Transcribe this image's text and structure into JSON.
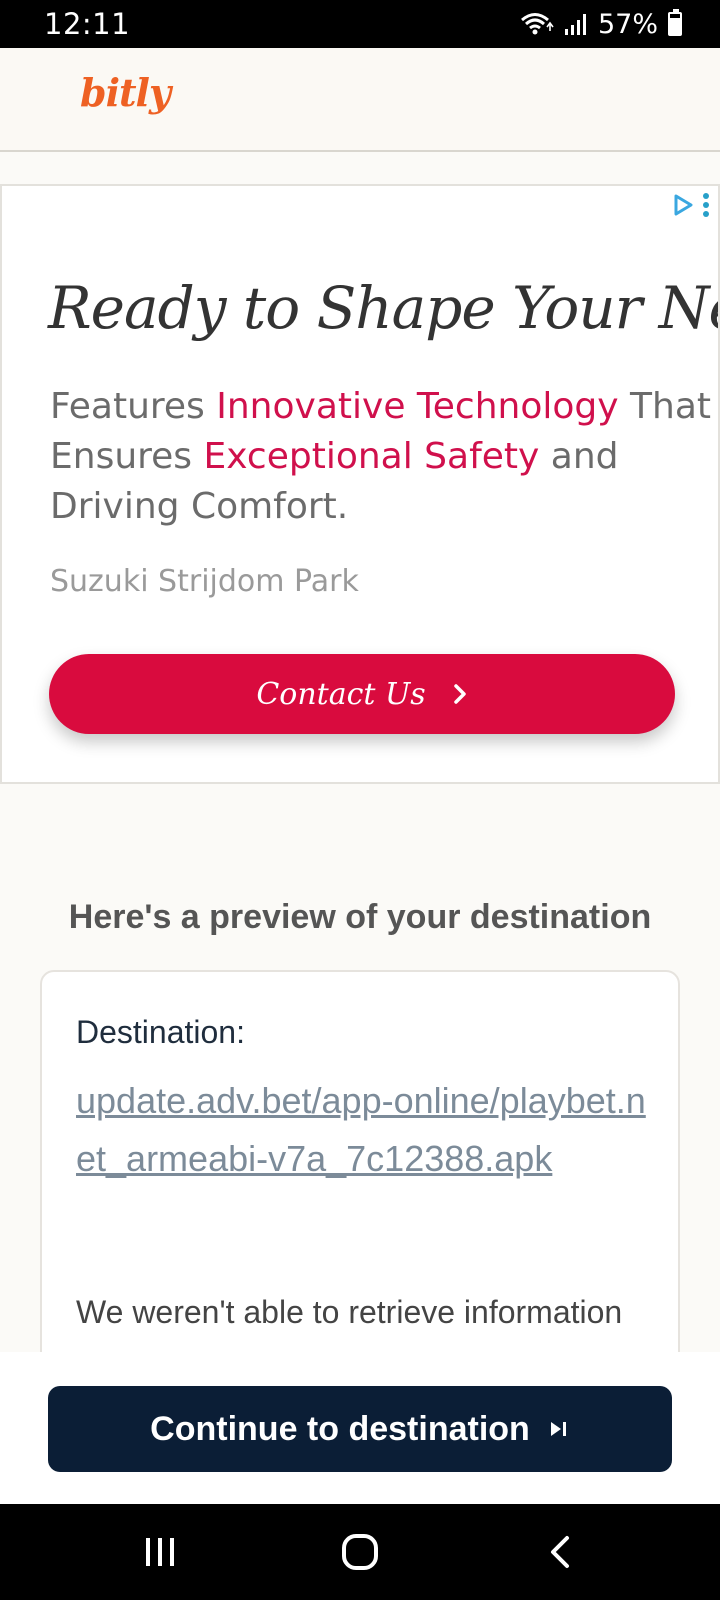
{
  "status_bar": {
    "time": "12:11",
    "battery": "57%",
    "icons": [
      "wifi-icon",
      "signal-icon",
      "battery-icon"
    ]
  },
  "header": {
    "logo_text": "bitly",
    "logo_color": "#ee6123"
  },
  "ad": {
    "headline": "Ready to Shape Your New",
    "body_parts": {
      "p1": "Features ",
      "hl1": "Innovative Technology",
      "p2": " That",
      "p3": "Ensures ",
      "hl2": "Exceptional Safety",
      "p4": " and",
      "p5": "Driving Comfort."
    },
    "advertiser": "Suzuki Strijdom Park",
    "cta_label": "Contact Us",
    "cta_color": "#d90b3e",
    "highlight_color": "#d0104c"
  },
  "preview": {
    "heading": "Here's a preview of your destination",
    "destination_label": "Destination:",
    "destination_url": "update.adv.bet/app-online/playbet.net_armeabi-v7a_7c12388.apk",
    "info_text": "We weren't able to retrieve information about"
  },
  "continue_button": {
    "label": "Continue to destination",
    "color": "#0b1e36"
  },
  "nav_bar": {
    "icons": [
      "recent-apps-icon",
      "home-icon",
      "back-icon"
    ]
  }
}
